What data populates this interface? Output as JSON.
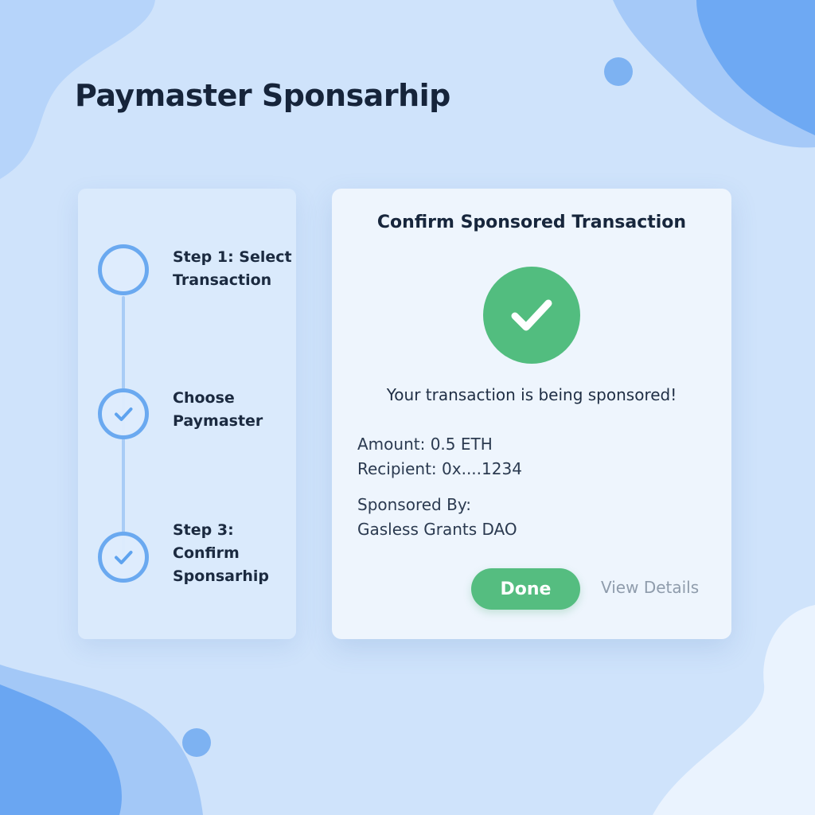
{
  "page": {
    "title": "Paymaster Sponsarhip"
  },
  "steps": [
    {
      "lines": [
        "Step 1: Select",
        "Transaction"
      ],
      "state": "empty",
      "icon": "empty-circle-icon"
    },
    {
      "lines": [
        "Choose",
        "Paymaster"
      ],
      "state": "complete",
      "icon": "check-icon"
    },
    {
      "lines": [
        "Step 3:",
        "Confirm",
        "Sponsarhip"
      ],
      "state": "complete",
      "icon": "check-icon"
    }
  ],
  "card": {
    "title": "Confirm Sponsored Transaction",
    "status_icon": "check-circle-icon",
    "status_message": "Your transaction is being sponsored!",
    "amount": "Amount: 0.5 ETH",
    "recipient": "Recipient: 0x....1234",
    "sponsored_by_label": "Sponsored By:",
    "sponsor_name": "Gasless Grants DAO",
    "done_label": "Done",
    "view_details_label": "View Details"
  },
  "colors": {
    "background": "#cfe3fb",
    "accent_blue": "#6aa9f0",
    "success_green": "#52bd7f",
    "title_text": "#16243a",
    "muted_link": "#8f9cac"
  }
}
